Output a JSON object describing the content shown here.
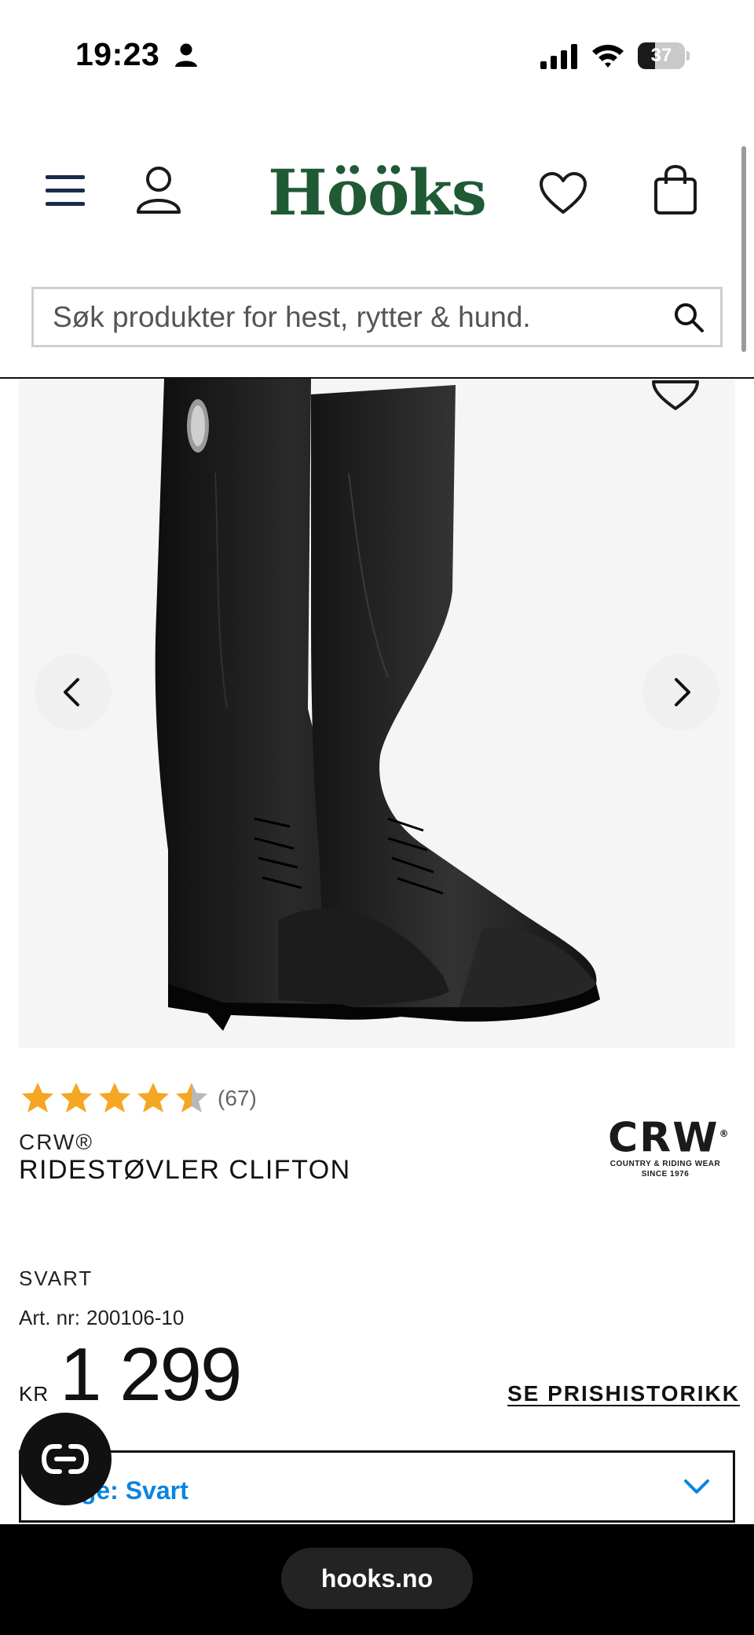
{
  "status_bar": {
    "time": "19:23",
    "battery_percent": "37",
    "battery_level": 0.37
  },
  "header": {
    "logo_text": "Hööks",
    "brand_color": "#1f5a35"
  },
  "search": {
    "placeholder": "Søk produkter for hest, rytter & hund."
  },
  "product": {
    "rating": 4.5,
    "rating_max": 5,
    "review_count": "(67)",
    "brand": "CRW®",
    "title": "RIDESTØVLER CLIFTON",
    "brand_logo": {
      "main": "CRW",
      "registered": "®",
      "line1": "COUNTRY & RIDING WEAR",
      "line2": "SINCE 1976"
    },
    "color": "SVART",
    "art_nr_label": "Art. nr:",
    "art_nr_value": "200106-10",
    "currency": "KR",
    "price": "1 299",
    "price_history_link": "SE PRISHISTORIKK",
    "variant_select": {
      "selected_label": "Farge: Svart",
      "accent_color": "#0a84e0"
    }
  },
  "browser": {
    "url": "hooks.no"
  },
  "icons": {
    "menu": "hamburger-menu-icon",
    "account": "user-icon",
    "wishlist": "heart-icon",
    "cart": "shopping-bag-icon",
    "search": "search-icon",
    "prev": "chevron-left-icon",
    "next": "chevron-right-icon",
    "chat": "chat-icon"
  },
  "colors": {
    "star_filled": "#f5a623",
    "star_empty": "#b8b8b8"
  }
}
